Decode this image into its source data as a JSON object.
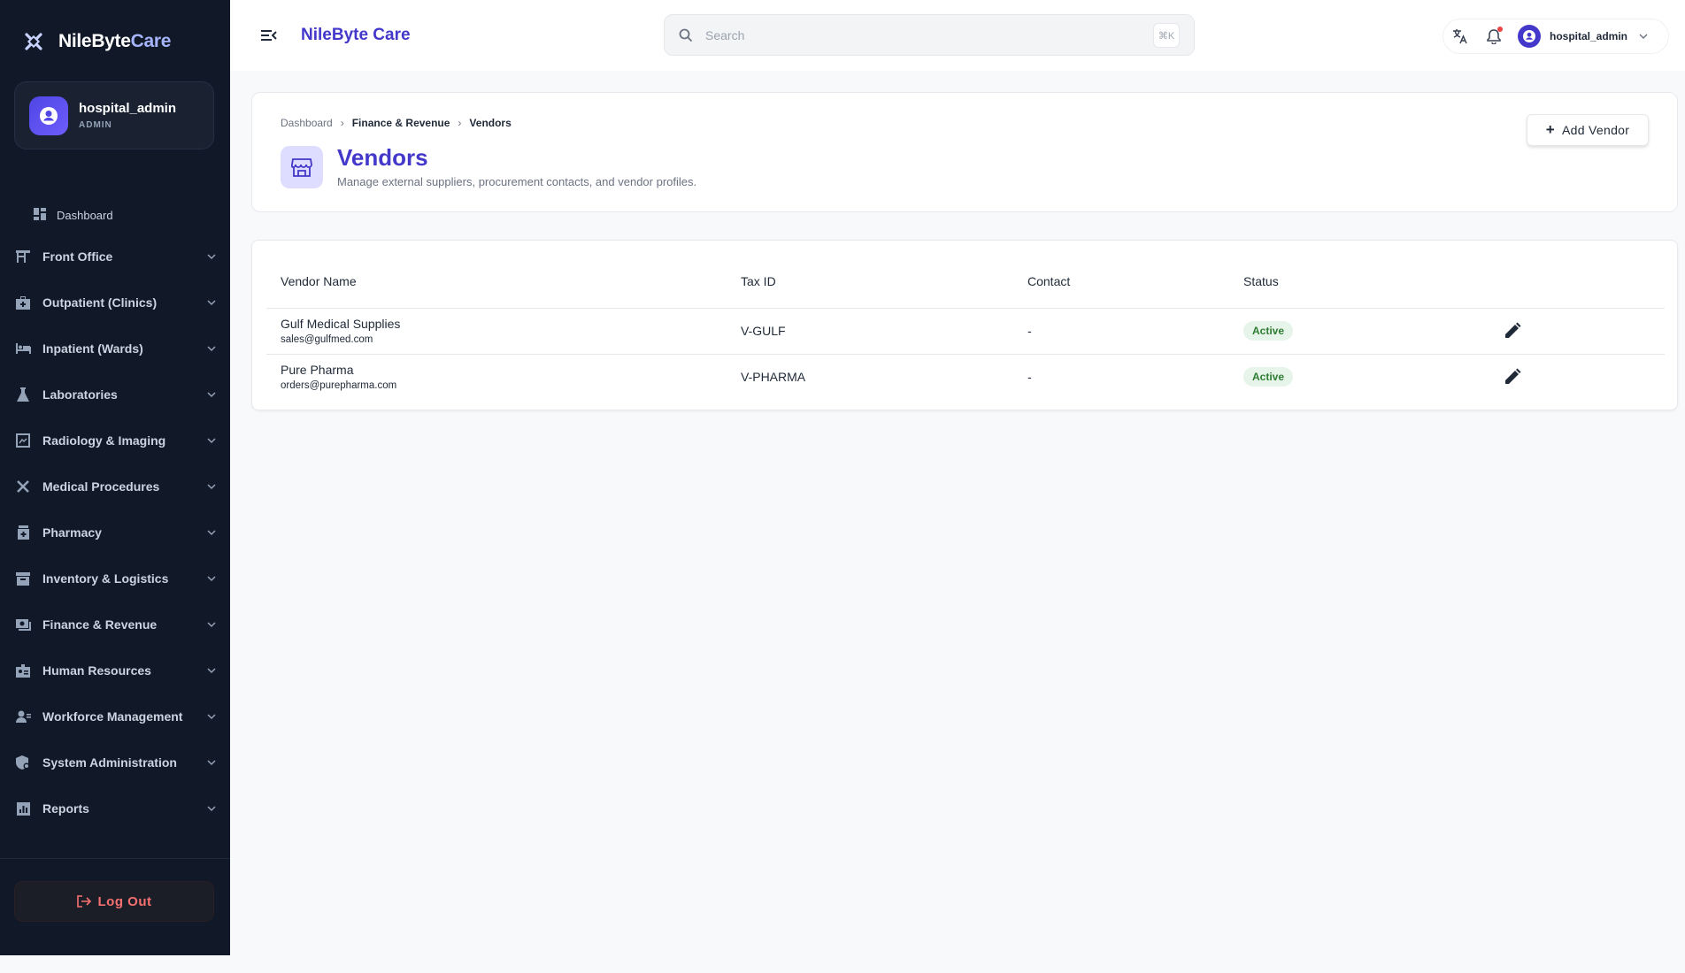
{
  "brand": {
    "name_part1": "NileByte",
    "name_part2": "Care"
  },
  "sidebar": {
    "user": {
      "name": "hospital_admin",
      "role": "ADMIN"
    },
    "dashboard_label": "Dashboard",
    "items": [
      {
        "label": "Front Office",
        "icon": "reception-desk-icon"
      },
      {
        "label": "Outpatient (Clinics)",
        "icon": "medical-bag-icon"
      },
      {
        "label": "Inpatient (Wards)",
        "icon": "bed-icon"
      },
      {
        "label": "Laboratories",
        "icon": "flask-icon"
      },
      {
        "label": "Radiology & Imaging",
        "icon": "scan-icon"
      },
      {
        "label": "Medical Procedures",
        "icon": "tools-icon"
      },
      {
        "label": "Pharmacy",
        "icon": "medicine-bottle-icon"
      },
      {
        "label": "Inventory & Logistics",
        "icon": "archive-box-icon"
      },
      {
        "label": "Finance & Revenue",
        "icon": "money-icon"
      },
      {
        "label": "Human Resources",
        "icon": "badge-icon"
      },
      {
        "label": "Workforce Management",
        "icon": "people-icon"
      },
      {
        "label": "System Administration",
        "icon": "admin-shield-icon"
      },
      {
        "label": "Reports",
        "icon": "bar-chart-icon"
      }
    ],
    "logout_label": "Log Out"
  },
  "header": {
    "title": "NileByte Care",
    "search_placeholder": "Search",
    "search_shortcut": "⌘K",
    "user_name": "hospital_admin"
  },
  "page": {
    "breadcrumb": [
      "Dashboard",
      "Finance & Revenue",
      "Vendors"
    ],
    "title": "Vendors",
    "subtitle": "Manage external suppliers, procurement contacts, and vendor profiles.",
    "add_button_label": "Add Vendor"
  },
  "table": {
    "columns": [
      "Vendor Name",
      "Tax ID",
      "Contact",
      "Status",
      ""
    ],
    "rows": [
      {
        "name": "Gulf Medical Supplies",
        "email": "sales@gulfmed.com",
        "tax_id": "V-GULF",
        "contact": "-",
        "status": "Active"
      },
      {
        "name": "Pure Pharma",
        "email": "orders@purepharma.com",
        "tax_id": "V-PHARMA",
        "contact": "-",
        "status": "Active"
      }
    ]
  },
  "colors": {
    "sidebar_bg": "#111827",
    "accent": "#4338ca",
    "status_active_bg": "#e6f4ea",
    "status_active_text": "#2e7d32",
    "logout": "#f87171"
  }
}
